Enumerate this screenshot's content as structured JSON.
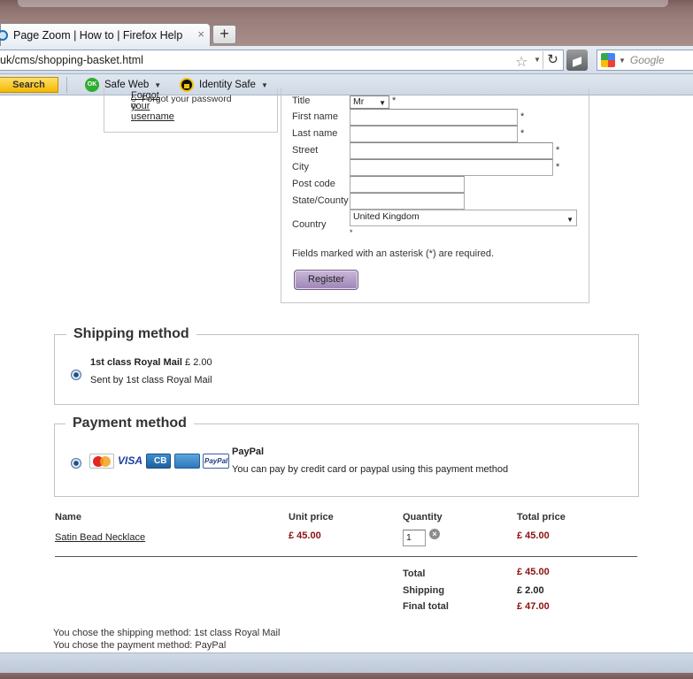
{
  "browser": {
    "tab_title": "Page Zoom | How to | Firefox Help",
    "tab_close": "×",
    "new_tab": "+",
    "url": "uk/cms/shopping-basket.html",
    "search_placeholder": "Google",
    "toolbar": {
      "search_button": "Search",
      "safe_web": "Safe Web",
      "safe_web_badge": "OK",
      "identity_safe": "Identity Safe"
    }
  },
  "login": {
    "links": [
      "Forgot your password",
      "Forgot your username"
    ]
  },
  "registration": {
    "fields": {
      "title_label": "Title",
      "title_value": "Mr",
      "first_name_label": "First name",
      "last_name_label": "Last name",
      "street_label": "Street",
      "city_label": "City",
      "post_code_label": "Post code",
      "state_label": "State/County",
      "country_label": "Country",
      "country_value": "United Kingdom"
    },
    "asterisk": "*",
    "note": "Fields marked with an asterisk (*) are required.",
    "register_button": "Register"
  },
  "shipping": {
    "legend": "Shipping method",
    "option_name": "1st class Royal Mail",
    "option_price": "£ 2.00",
    "option_desc": "Sent by 1st class Royal Mail"
  },
  "payment": {
    "legend": "Payment method",
    "option_name": "PayPal",
    "option_desc": "You can pay by credit card or paypal using this payment method",
    "card_icons": [
      "mastercard-icon",
      "visa-icon",
      "cb-icon",
      "amex-icon",
      "paypal-icon"
    ],
    "visa_text": "VISA"
  },
  "basket": {
    "headers": [
      "Name",
      "Unit price",
      "Quantity",
      "Total price"
    ],
    "items": [
      {
        "name": "Satin Bead Necklace",
        "unit_price": "£ 45.00",
        "quantity": "1",
        "total_price": "£ 45.00"
      }
    ],
    "totals": [
      {
        "label": "Total",
        "value": "£ 45.00"
      },
      {
        "label": "Shipping",
        "value": "£ 2.00"
      },
      {
        "label": "Final total",
        "value": "£ 47.00"
      }
    ],
    "summary": [
      "You chose the shipping method: 1st class Royal Mail",
      "You chose the payment method: PayPal"
    ]
  },
  "colors": {
    "price_red": "#8b1010",
    "register_purple": "#9d85b6",
    "search_yellow": "#f5b800"
  }
}
